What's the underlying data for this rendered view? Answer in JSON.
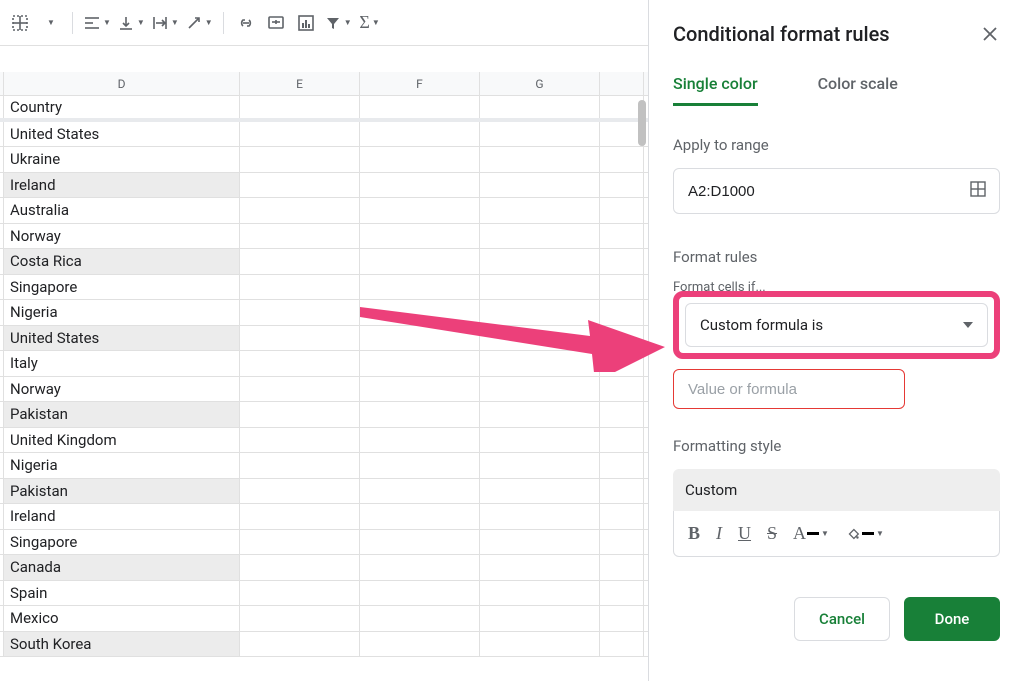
{
  "toolbar": {
    "collapse": "▲"
  },
  "grid": {
    "columns": [
      "D",
      "E",
      "F",
      "G"
    ],
    "header": "Country",
    "rows": [
      {
        "d": "United States",
        "selected": false
      },
      {
        "d": "Ukraine",
        "selected": false
      },
      {
        "d": "Ireland",
        "selected": true
      },
      {
        "d": "Australia",
        "selected": false
      },
      {
        "d": "Norway",
        "selected": false
      },
      {
        "d": "Costa Rica",
        "selected": true
      },
      {
        "d": "Singapore",
        "selected": false
      },
      {
        "d": "Nigeria",
        "selected": false
      },
      {
        "d": "United States",
        "selected": true
      },
      {
        "d": "Italy",
        "selected": false
      },
      {
        "d": "Norway",
        "selected": false
      },
      {
        "d": "Pakistan",
        "selected": true
      },
      {
        "d": "United Kingdom",
        "selected": false
      },
      {
        "d": "Nigeria",
        "selected": false
      },
      {
        "d": "Pakistan",
        "selected": true
      },
      {
        "d": "Ireland",
        "selected": false
      },
      {
        "d": "Singapore",
        "selected": false
      },
      {
        "d": "Canada",
        "selected": true
      },
      {
        "d": "Spain",
        "selected": false
      },
      {
        "d": "Mexico",
        "selected": false
      },
      {
        "d": "South Korea",
        "selected": true
      }
    ]
  },
  "sidebar": {
    "title": "Conditional format rules",
    "tabs": {
      "single": "Single color",
      "scale": "Color scale"
    },
    "apply_label": "Apply to range",
    "range_value": "A2:D1000",
    "format_rules_label": "Format rules",
    "cells_if_label": "Format cells if...",
    "condition_selected": "Custom formula is",
    "formula_placeholder": "Value or formula",
    "style_label": "Formatting style",
    "style_value": "Custom",
    "cancel": "Cancel",
    "done": "Done"
  }
}
